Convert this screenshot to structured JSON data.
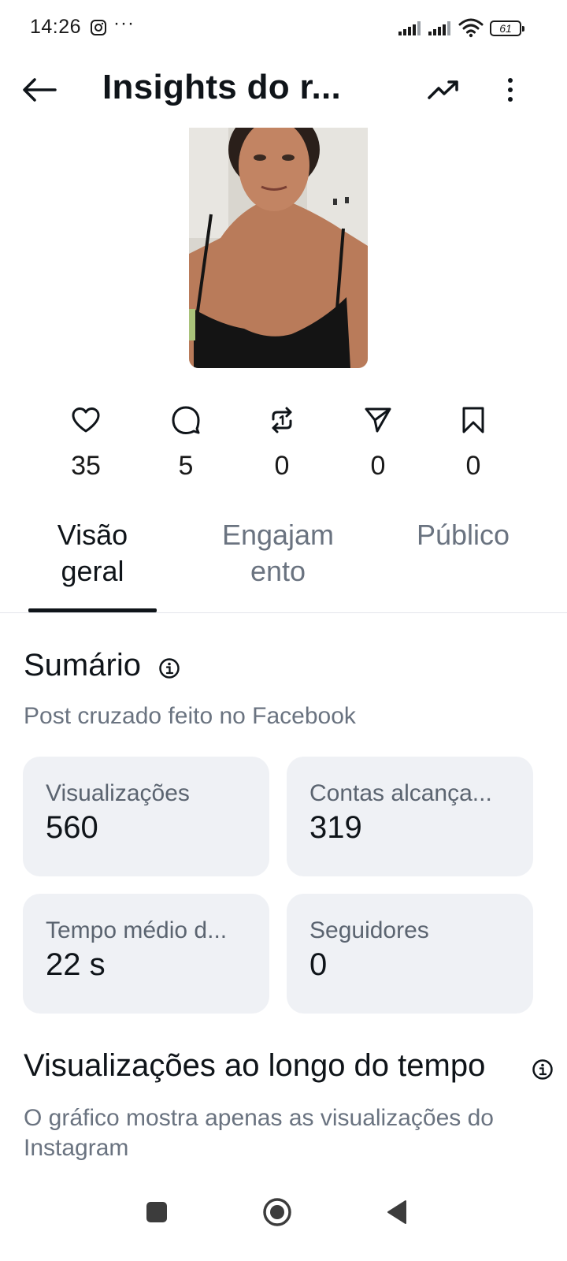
{
  "status_bar": {
    "time": "14:26",
    "more": "···",
    "battery": "61"
  },
  "header": {
    "title": "Insights do r..."
  },
  "post": {
    "thumbnail_alt": "Post thumbnail"
  },
  "stats": [
    {
      "icon": "heart-icon",
      "value": "35"
    },
    {
      "icon": "comment-icon",
      "value": "5"
    },
    {
      "icon": "repost-icon",
      "value": "0"
    },
    {
      "icon": "share-icon",
      "value": "0"
    },
    {
      "icon": "bookmark-icon",
      "value": "0"
    }
  ],
  "tabs": [
    {
      "label": "Visão geral",
      "active": true
    },
    {
      "label": "Engajam ento",
      "active": false
    },
    {
      "label": "Público",
      "active": false
    }
  ],
  "summary": {
    "title": "Sumário",
    "subtitle": "Post cruzado feito no Facebook",
    "cards": [
      {
        "label": "Visualizações",
        "value": "560"
      },
      {
        "label": "Contas alcança...",
        "value": "319"
      },
      {
        "label": "Tempo médio d...",
        "value": "22 s"
      },
      {
        "label": "Seguidores",
        "value": "0"
      }
    ]
  },
  "views_over_time": {
    "title": "Visualizações ao longo do tempo",
    "subtitle": "O gráfico mostra apenas as visualizações do Instagram"
  },
  "colors": {
    "text_primary": "#0f1419",
    "text_secondary": "#6a7380",
    "card_bg": "#eff1f5"
  }
}
